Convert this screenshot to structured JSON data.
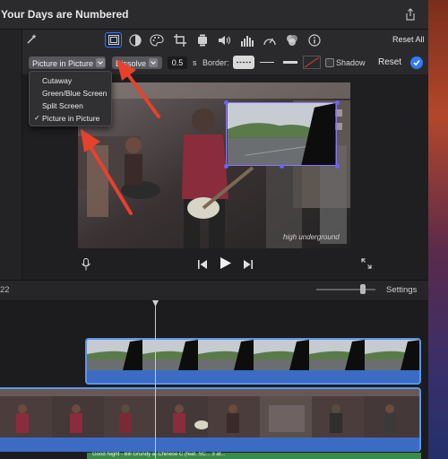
{
  "window": {
    "title": "Your Days are Numbered",
    "share_icon": "share-icon"
  },
  "toolbar": {
    "magic_icon": "magic-wand-icon",
    "tools": [
      {
        "name": "video-overlay-icon",
        "selected": true
      },
      {
        "name": "color-balance-icon",
        "selected": false
      },
      {
        "name": "color-correction-icon",
        "selected": false
      },
      {
        "name": "crop-icon",
        "selected": false
      },
      {
        "name": "stabilization-icon",
        "selected": false
      },
      {
        "name": "volume-icon",
        "selected": false
      },
      {
        "name": "noise-reduction-eq-icon",
        "selected": false
      },
      {
        "name": "speed-icon",
        "selected": false
      },
      {
        "name": "clip-filter-icon",
        "selected": false
      },
      {
        "name": "info-icon",
        "selected": false
      }
    ],
    "reset_all_label": "Reset All"
  },
  "overlay_controls": {
    "overlay_style": "Picture in Picture",
    "transition": "Dissolve",
    "duration": "0.5",
    "duration_unit": "s",
    "border_label": "Border:",
    "shadow_label": "Shadow",
    "shadow_checked": false,
    "reset_label": "Reset",
    "apply_icon": "checkmark-icon"
  },
  "overlay_menu": {
    "items": [
      {
        "label": "Cutaway",
        "checked": false
      },
      {
        "label": "Green/Blue Screen",
        "checked": false
      },
      {
        "label": "Split Screen",
        "checked": false
      },
      {
        "label": "Picture in Picture",
        "checked": true
      }
    ]
  },
  "viewer": {
    "watermark": "high underground",
    "microphone_icon": "microphone-icon",
    "skip_back_icon": "skip-back-icon",
    "play_icon": "play-icon",
    "skip_forward_icon": "skip-forward-icon",
    "fullscreen_icon": "fullscreen-icon"
  },
  "timeline": {
    "timecode": "22",
    "settings_label": "Settings",
    "audio_clip_text": "Good Night - Bill Grundy at Chinese C (feat. SC... 3 at..."
  },
  "colors": {
    "accent": "#3478f6",
    "clip_border": "#5b95e8",
    "audio_clip": "#3a8a4a",
    "arrow": "#e8412b"
  }
}
